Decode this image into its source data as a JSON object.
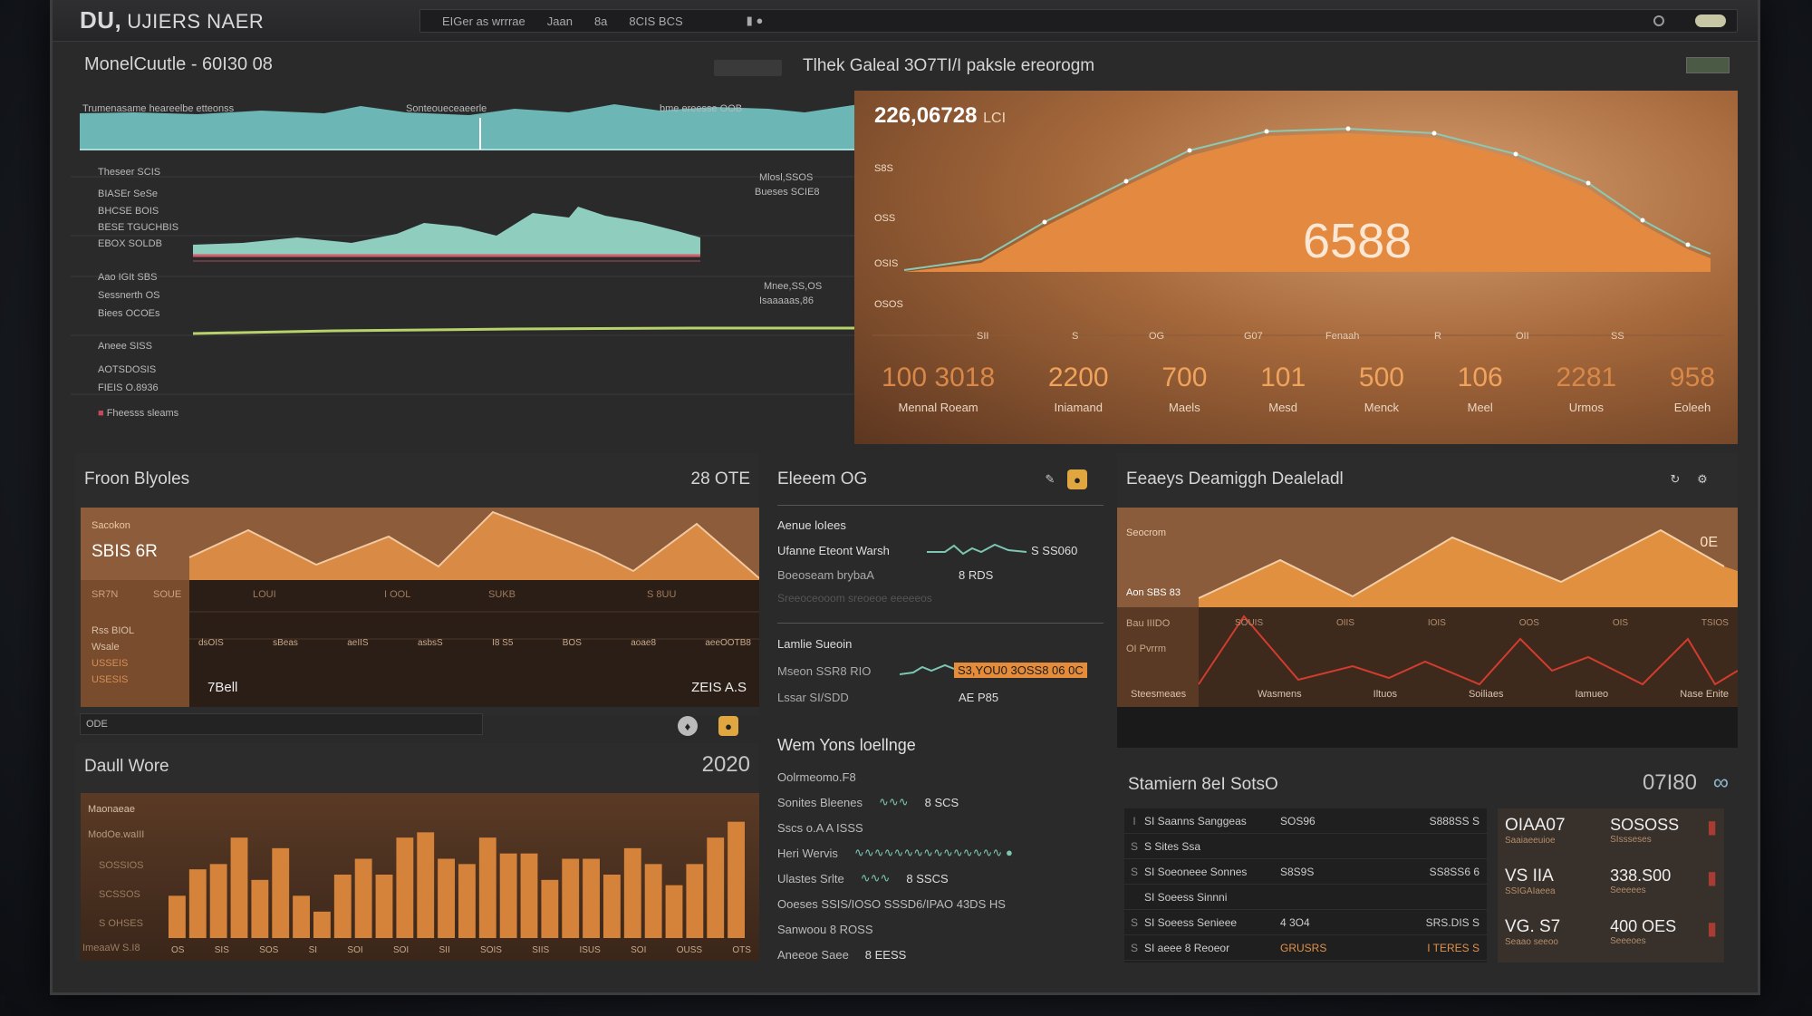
{
  "app": {
    "brand_bold": "DU,",
    "brand_text": "UJIERS NAER"
  },
  "menubar": {
    "items": [
      "EIGer as wrrrae",
      "Jaan",
      "8a",
      "8CIS BCS"
    ],
    "right_icons": [
      "toggle-icon",
      "circle-icon"
    ]
  },
  "header": {
    "left_title": "MonelCuutle - 60I30 08",
    "center_title": "Tlhek Galeal 3O7TI/I paksle ereorogm"
  },
  "monitor_panel": {
    "top_labels": [
      "Trumenasame heareelbe etteonss",
      "Sonteoueceaeerle",
      "bme ereesse OOB"
    ],
    "rows_group1": [
      "Theseer SCIS",
      "BIASEr SeSe",
      "BHCSE BOIS",
      "BESE TGUCHBIS",
      "EBOX SOLDB"
    ],
    "rows_group2": [
      "Aao IGIt SBS",
      "Sessnerth OS",
      "Biees OCOEs"
    ],
    "rows_group3": [
      "Aneee SISS",
      "AOTSDOSIS",
      "FIEIS O.8936"
    ],
    "legend_last": "Fheesss sleams",
    "annot1": [
      "Mlosl,SSOS",
      "Bueses SCIE8"
    ],
    "annot2": [
      "Mnee,SS,OS",
      "Isaaaaas,86"
    ]
  },
  "big_chart": {
    "value_title": "226,06728",
    "value_suffix": "LCI",
    "center_value": "6588",
    "y_labels": [
      "S8S",
      "OSS",
      "OSIS",
      "OSOS"
    ],
    "x_labels": [
      "SII",
      "S",
      "OG",
      "G07",
      "Fenaah",
      "R",
      "OII",
      "SS"
    ],
    "stats": [
      {
        "value": "100 3018",
        "label": "Mennal Roeam"
      },
      {
        "value": "2200",
        "label": "Iniamand"
      },
      {
        "value": "700",
        "label": "Maels"
      },
      {
        "value": "101",
        "label": "Mesd"
      },
      {
        "value": "500",
        "label": "Menck"
      },
      {
        "value": "106",
        "label": "Meel"
      },
      {
        "value": "2281",
        "label": "Urmos"
      },
      {
        "value": "958",
        "label": "Eoleeh"
      }
    ]
  },
  "flown_panel": {
    "title": "Froon Blyoles",
    "title_right": "28 OTE",
    "value_label": "Sacokon",
    "value": "SBIS 6R",
    "row_labels": [
      "SR7N",
      "SOUE"
    ],
    "grid_labels": [
      "LOUI",
      "I OOL",
      "SUKB",
      "S 8UU"
    ],
    "axis_labels": [
      "dsOIS",
      "sBeas",
      "aeIIS",
      "asbsS",
      "I8 S5",
      "BOS",
      "aoae8",
      "aeeOOTB8"
    ],
    "side_labels": [
      "Rss BIOL",
      "Wsale",
      "USSEIS",
      "USESIS"
    ],
    "bottom_left": "7Bell",
    "bottom_right": "ZEIS A.S",
    "footer_bar_label": "ODE"
  },
  "daily_panel": {
    "title": "Daull Wore",
    "title_right": "2020",
    "y_labels": [
      "Maonaeae",
      "ModOe.waIII",
      "SOSSIOS",
      "SCSSOS",
      "S OHSES",
      "ImeaaW S.I8"
    ],
    "x_labels": [
      "OS",
      "SIS",
      "SOS",
      "SI",
      "SOI",
      "SOI",
      "SII",
      "SOIS",
      "SIIS",
      "ISUS",
      "SOI",
      "OUSS",
      "OTS"
    ],
    "bars": [
      40,
      65,
      70,
      95,
      55,
      85,
      40,
      25,
      60,
      75,
      60,
      95,
      100,
      75,
      70,
      95,
      80,
      80,
      55,
      75,
      75,
      60,
      85,
      70,
      50,
      70,
      95,
      110
    ]
  },
  "middle_panel": {
    "title": "Eleeem OG",
    "sec1_title": "Aenue loIees",
    "sec1_rows": [
      {
        "label": "Ufanne Eteont Warsh",
        "value": "S SS060"
      },
      {
        "label": "Boeoseam brybaA",
        "value": "8 RDS"
      },
      {
        "label": "Sreeoceooom sreoeoe eeeeeos",
        "value": ""
      }
    ],
    "sec2_title": "Lamlie Sueoin",
    "sec2_rows": [
      {
        "label": "Mseon SSR8 RIO",
        "highlight": "S3,YOU0 3OSS8 06 0C"
      },
      {
        "label": "Lssar SI/SDD",
        "value": "AE P85"
      }
    ],
    "sec3_title": "Wem Yons loellnge",
    "sec3_rows": [
      {
        "label": "Oolrmeomo.F8",
        "value": ""
      },
      {
        "label": "Sonites Bleenes",
        "value": "8 SCS"
      },
      {
        "label": "Sscs o.A A ISSS",
        "value": ""
      },
      {
        "label": "Heri Wervis",
        "value": ""
      },
      {
        "label": "Ulastes Srlte",
        "value": "8 SSCS"
      },
      {
        "label": "Ooeses SSIS/IOSO SSSD6/IPAO 43DS HS",
        "value": ""
      },
      {
        "label": "Sanwoou 8 ROSS",
        "value": ""
      },
      {
        "label": "Aneeoe Saee",
        "value": "8 EESS"
      }
    ]
  },
  "dashboard_panel": {
    "title": "Eeaeys Deamiggh Dealeladl",
    "corner_value": "0E",
    "value_label": "Seocrom",
    "value": "Aon SBS 83",
    "left_labels": [
      "Bau IIIDO",
      "OI Pvrrm"
    ],
    "grid_labels": [
      "SOUIS",
      "OIIS",
      "IOIS",
      "OOS",
      "OIS",
      "TSIOS"
    ],
    "axis_labels": [
      "Steesmeaes",
      "Wasmens",
      "Iltuos",
      "Soiliaes",
      "Iamueo",
      "Nase Enite"
    ]
  },
  "sessions_panel": {
    "title": "Stamiern 8eI SotsO",
    "title_right": "07I80",
    "rows": [
      {
        "idx": "I",
        "label": "SI Saanns Sanggeas",
        "v1": "SOS96",
        "v2": "S888SS S"
      },
      {
        "idx": "S",
        "label": "S Sites Ssa",
        "v1": "",
        "v2": ""
      },
      {
        "idx": "S",
        "label": "SI Soeoneee Sonnes",
        "v1": "S8S9S",
        "v2": "SS8SS6 6"
      },
      {
        "idx": "",
        "label": "SI Soeess Sinnni",
        "v1": "",
        "v2": ""
      },
      {
        "idx": "S",
        "label": "SI Soeess Senieee",
        "v1": "4 3O4",
        "v2": "SRS.DIS S"
      },
      {
        "idx": "S",
        "label": "SI aeee 8 Reoeor",
        "v1": "GRUSRS",
        "v2": "I TERES S"
      }
    ],
    "kpis": [
      {
        "value": "OIAA07",
        "label": "Saaiaeeuioe",
        "value2": "SOSOSS",
        "label2": "SIssseses"
      },
      {
        "value": "VS IIA",
        "label": "SSIGAIaeea",
        "value2": "338.S00",
        "label2": "Seeeees"
      },
      {
        "value": "VG. S7",
        "label": "Seaao seeoo",
        "value2": "400 OES",
        "label2": "Seeeoes"
      }
    ]
  }
}
